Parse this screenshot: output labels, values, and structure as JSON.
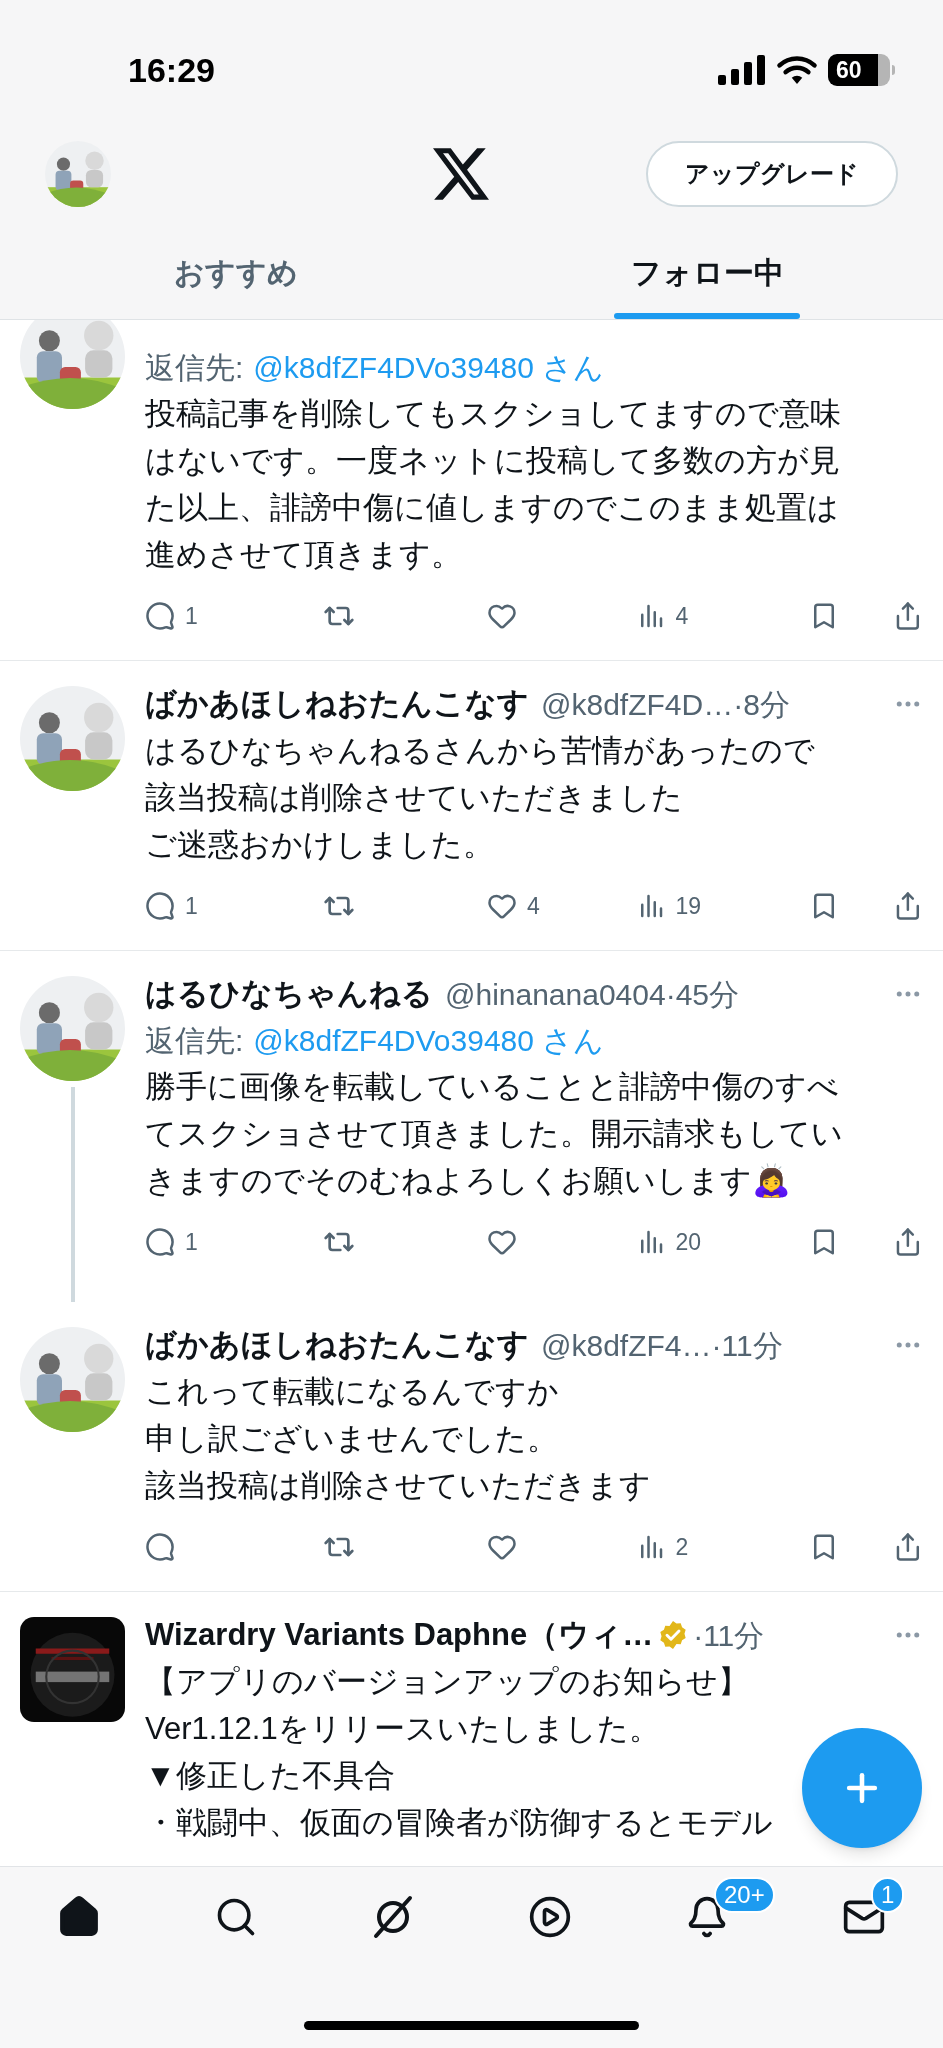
{
  "status_bar": {
    "time": "16:29",
    "battery": "60"
  },
  "header": {
    "upgrade_button": "アップグレード"
  },
  "tabs": [
    {
      "label": "おすすめ",
      "selected": false
    },
    {
      "label": "フォロー中",
      "selected": true
    }
  ],
  "tweets": [
    {
      "avatar": {
        "kind": "circle"
      },
      "reply_label": "返信先:",
      "reply_to": "@k8dfZF4DVo39480 さん",
      "lines": [
        "投稿記事を削除してもスクショしてますので意味",
        "はないです。一度ネットに投稿して多数の方が見",
        "た以上、誹謗中傷に値しますのでこのまま処置は",
        "進めさせて頂きます。"
      ],
      "thread_line": false,
      "actions": {
        "reply": "1",
        "views": "4"
      }
    },
    {
      "avatar": {
        "kind": "circle"
      },
      "name": "ばかあほしねおたんこなす",
      "handle": "@k8dfZF4D…",
      "time": "·8分",
      "lines": [
        "はるひなちゃんねるさんから苦情があったので",
        "該当投稿は削除させていただきました",
        "ご迷惑おかけしました。"
      ],
      "thread_line": false,
      "actions": {
        "reply": "1",
        "like": "4",
        "views": "19"
      }
    },
    {
      "avatar": {
        "kind": "circle"
      },
      "name": "はるひなちゃんねる",
      "handle": "@hinanana0404",
      "time": "·45分",
      "reply_label": "返信先:",
      "reply_to": "@k8dfZF4DVo39480 さん",
      "lines": [
        "勝手に画像を転載していることと誹謗中傷のすべ",
        "てスクショさせて頂きました。開示請求もしてい",
        "きますのでそのむねよろしくお願いします🙇‍♀️"
      ],
      "thread_line": true,
      "actions": {
        "reply": "1",
        "views": "20"
      }
    },
    {
      "avatar": {
        "kind": "circle"
      },
      "name": "ばかあほしねおたんこなす",
      "handle": "@k8dfZF4…",
      "time": "·11分",
      "lines": [
        "これって転載になるんですか",
        "申し訳ございませんでした。",
        "該当投稿は削除させていただきます"
      ],
      "thread_line": false,
      "actions": {
        "views": "2"
      }
    },
    {
      "avatar": {
        "kind": "square"
      },
      "name": "Wizardry Variants Daphne（ウィ…",
      "verified": true,
      "time": "·11分",
      "lines": [
        "【アプリのバージョンアップのお知らせ】",
        "Ver1.12.1をリリースいたしました。",
        "▼修正した不具合",
        "・戦闘中、仮面の冒険者が防御するとモデル"
      ],
      "thread_line": false
    }
  ],
  "bottom_nav": [
    {
      "kind": "home",
      "selected": true
    },
    {
      "kind": "search",
      "selected": false
    },
    {
      "kind": "grok",
      "selected": false
    },
    {
      "kind": "video",
      "selected": false
    },
    {
      "kind": "notifications",
      "selected": false,
      "badge": "20+"
    },
    {
      "kind": "messages",
      "selected": false,
      "badge": "1"
    }
  ]
}
